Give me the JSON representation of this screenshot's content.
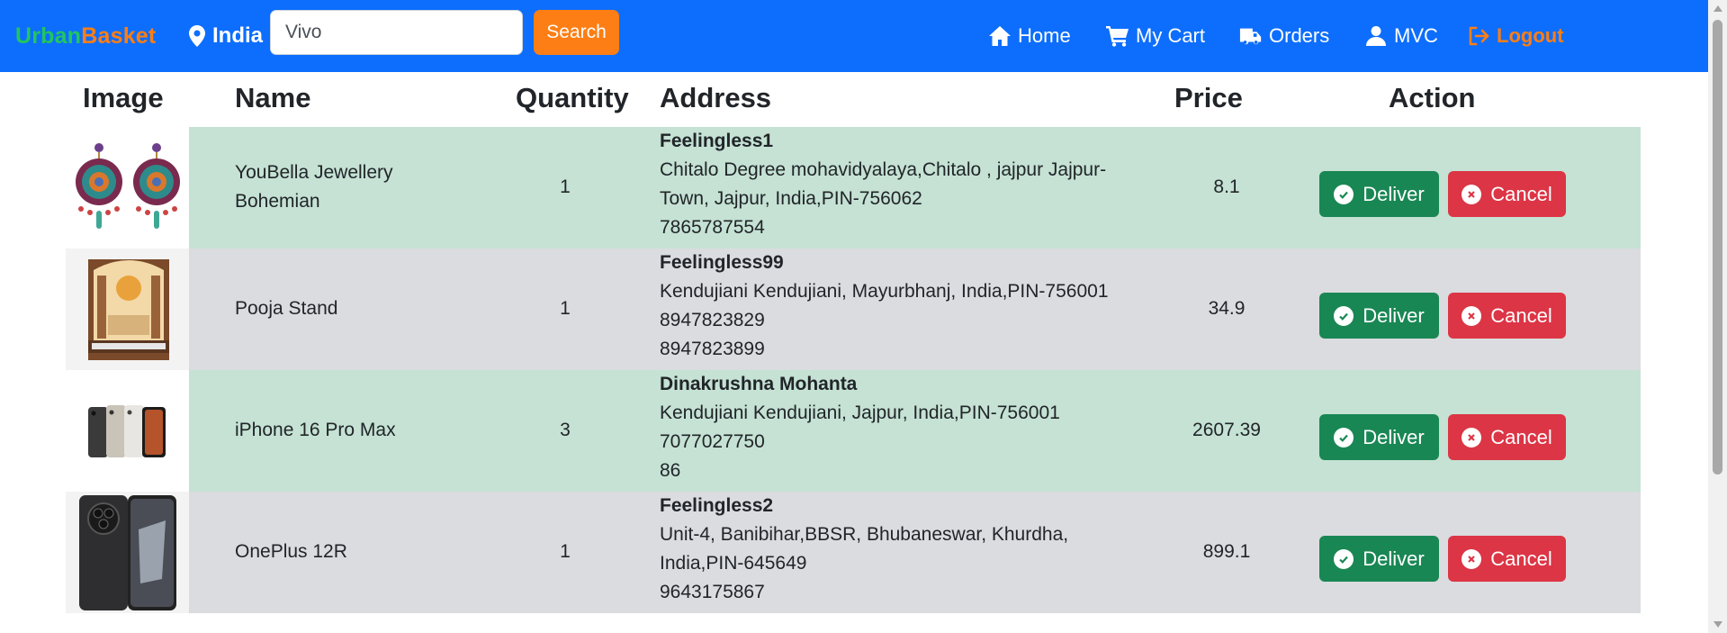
{
  "nav": {
    "brand_part1": "Urban",
    "brand_part2": "Basket",
    "location": "India",
    "search_value": "Vivo",
    "search_button": "Search",
    "links": [
      {
        "label": "Home",
        "icon": "home-icon"
      },
      {
        "label": "My Cart",
        "icon": "cart-icon"
      },
      {
        "label": "Orders",
        "icon": "truck-icon"
      },
      {
        "label": "MVC",
        "icon": "user-icon"
      },
      {
        "label": "Logout",
        "icon": "logout-icon"
      }
    ]
  },
  "table": {
    "headers": {
      "image": "Image",
      "name": "Name",
      "quantity": "Quantity",
      "address": "Address",
      "price": "Price",
      "action": "Action"
    },
    "rows": [
      {
        "name": "YouBella Jewellery Bohemian",
        "quantity": "1",
        "address_name": "Feelingless1",
        "address_line": "Chitalo Degree mohavidyalaya,Chitalo , jajpur Jajpur-Town, Jajpur, India,PIN-756062",
        "phone1": "7865787554",
        "phone2": "",
        "price": "8.1",
        "image_icon": "earrings-image"
      },
      {
        "name": "Pooja Stand",
        "quantity": "1",
        "address_name": "Feelingless99",
        "address_line": "Kendujiani Kendujiani, Mayurbhanj, India,PIN-756001",
        "phone1": "8947823829",
        "phone2": "8947823899",
        "price": "34.9",
        "image_icon": "pooja-stand-image"
      },
      {
        "name": "iPhone 16 Pro Max",
        "quantity": "3",
        "address_name": "Dinakrushna Mohanta",
        "address_line": "Kendujiani Kendujiani, Jajpur, India,PIN-756001",
        "phone1": "7077027750",
        "phone2": "86",
        "price": "2607.39",
        "image_icon": "iphone-image"
      },
      {
        "name": "OnePlus 12R",
        "quantity": "1",
        "address_name": "Feelingless2",
        "address_line": "Unit-4, Banibihar,BBSR, Bhubaneswar, Khurdha, India,PIN-645649",
        "phone1": "9643175867",
        "phone2": "",
        "price": "899.1",
        "image_icon": "oneplus-image"
      }
    ],
    "deliver_label": "Deliver",
    "cancel_label": "Cancel"
  },
  "colors": {
    "navbar": "#0d6efd",
    "brand_green": "#22c55e",
    "accent_orange": "#fd7e14",
    "row_green": "#c5e2d4",
    "row_gray": "#dbdcdf",
    "deliver": "#198754",
    "cancel": "#dc3545"
  }
}
